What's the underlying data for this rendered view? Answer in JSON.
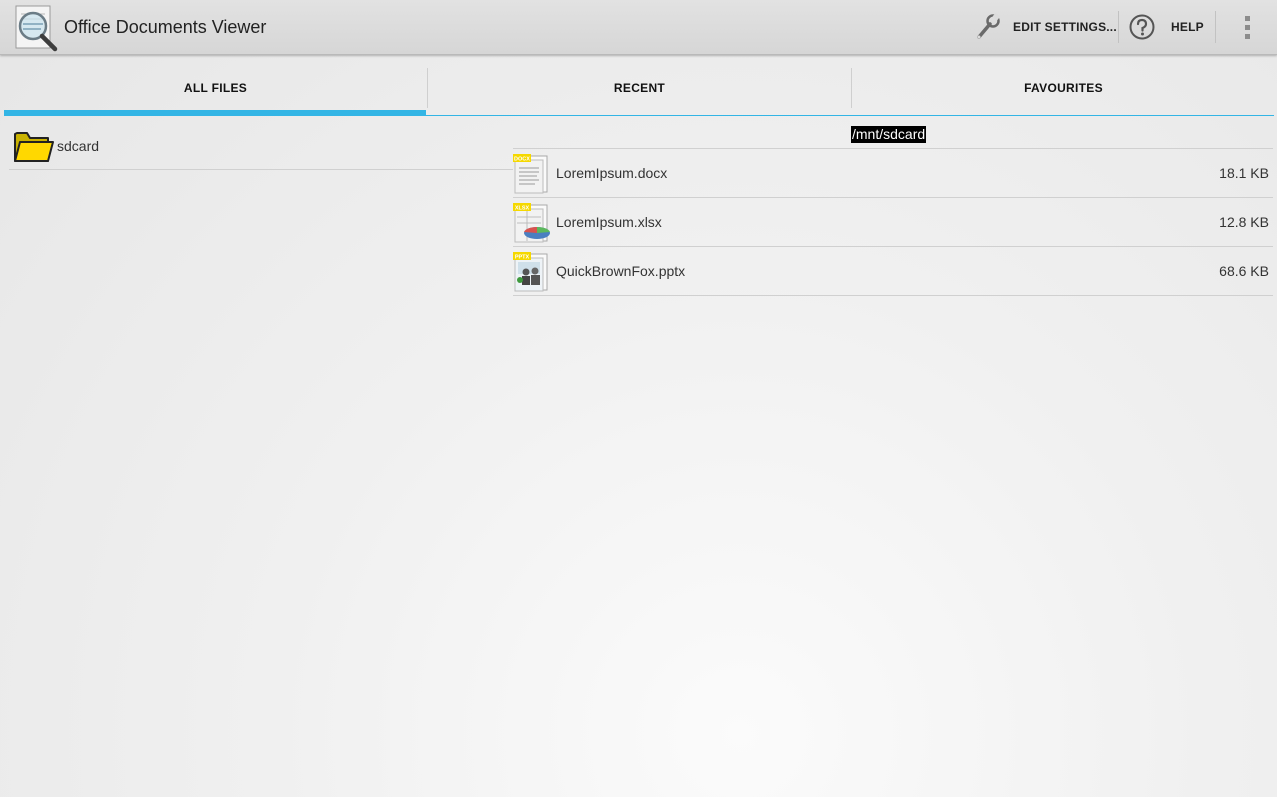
{
  "app": {
    "title": "Office Documents Viewer"
  },
  "actions": {
    "edit_settings": "EDIT SETTINGS...",
    "help": "HELP"
  },
  "tabs": [
    {
      "label": "ALL FILES",
      "selected": true
    },
    {
      "label": "RECENT",
      "selected": false
    },
    {
      "label": "FAVOURITES",
      "selected": false
    }
  ],
  "folders": [
    {
      "label": "sdcard",
      "icon": "folder-icon"
    }
  ],
  "current_path": "/mnt/sdcard",
  "files": [
    {
      "name": "LoremIpsum.docx",
      "size": "18.1 KB",
      "badge": "DOCX",
      "icon": "docx-file-icon"
    },
    {
      "name": "LoremIpsum.xlsx",
      "size": "12.8 KB",
      "badge": "XLSX",
      "icon": "xlsx-file-icon"
    },
    {
      "name": "QuickBrownFox.pptx",
      "size": "68.6 KB",
      "badge": "PPTX",
      "icon": "pptx-file-icon"
    }
  ],
  "colors": {
    "accent": "#33b5e5",
    "actionbar": "#dcdcdc",
    "badge": "#f5d800"
  }
}
